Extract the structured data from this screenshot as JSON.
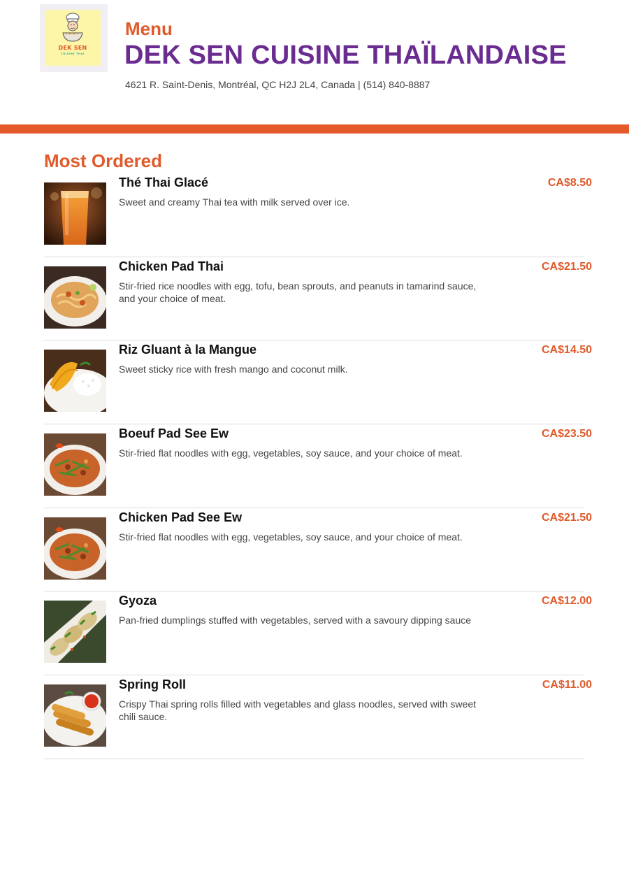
{
  "header": {
    "logo_text": "DEK SEN",
    "logo_subtext": "CUISINE THAI",
    "menu_label": "Menu",
    "restaurant_name": "DEK SEN CUISINE THAÏLANDAISE",
    "address": "4621 R. Saint-Denis, Montréal, QC H2J 2L4, Canada | (514) 840-8887"
  },
  "section": {
    "title": "Most Ordered"
  },
  "items": [
    {
      "name": "Thé Thai Glacé",
      "description": "Sweet and creamy Thai tea with milk served over ice.",
      "price": "CA$8.50",
      "image": "thai-iced-tea-photo"
    },
    {
      "name": "Chicken Pad Thai",
      "description": "Stir-fried rice noodles with egg, tofu, bean sprouts, and peanuts in tamarind sauce, and your choice of meat.",
      "price": "CA$21.50",
      "image": "pad-thai-photo"
    },
    {
      "name": "Riz Gluant à la Mangue",
      "description": "Sweet sticky rice with fresh mango and coconut milk.",
      "price": "CA$14.50",
      "image": "mango-sticky-rice-photo"
    },
    {
      "name": "Boeuf Pad See Ew",
      "description": "Stir-fried flat noodles with egg, vegetables, soy sauce, and your choice of meat.",
      "price": "CA$23.50",
      "image": "pad-see-ew-photo"
    },
    {
      "name": "Chicken Pad See Ew",
      "description": "Stir-fried flat noodles with egg, vegetables, soy sauce, and your choice of meat.",
      "price": "CA$21.50",
      "image": "pad-see-ew-photo"
    },
    {
      "name": "Gyoza",
      "description": "Pan-fried dumplings stuffed with vegetables, served with a savoury dipping sauce",
      "price": "CA$12.00",
      "image": "gyoza-photo"
    },
    {
      "name": "Spring Roll",
      "description": "Crispy Thai spring rolls filled with vegetables and glass noodles, served with sweet chili sauce.",
      "price": "CA$11.00",
      "image": "spring-roll-photo"
    }
  ],
  "colors": {
    "accent_orange": "#e05a2b",
    "brand_purple": "#6a2c91",
    "bar_orange": "#e55a2b"
  }
}
